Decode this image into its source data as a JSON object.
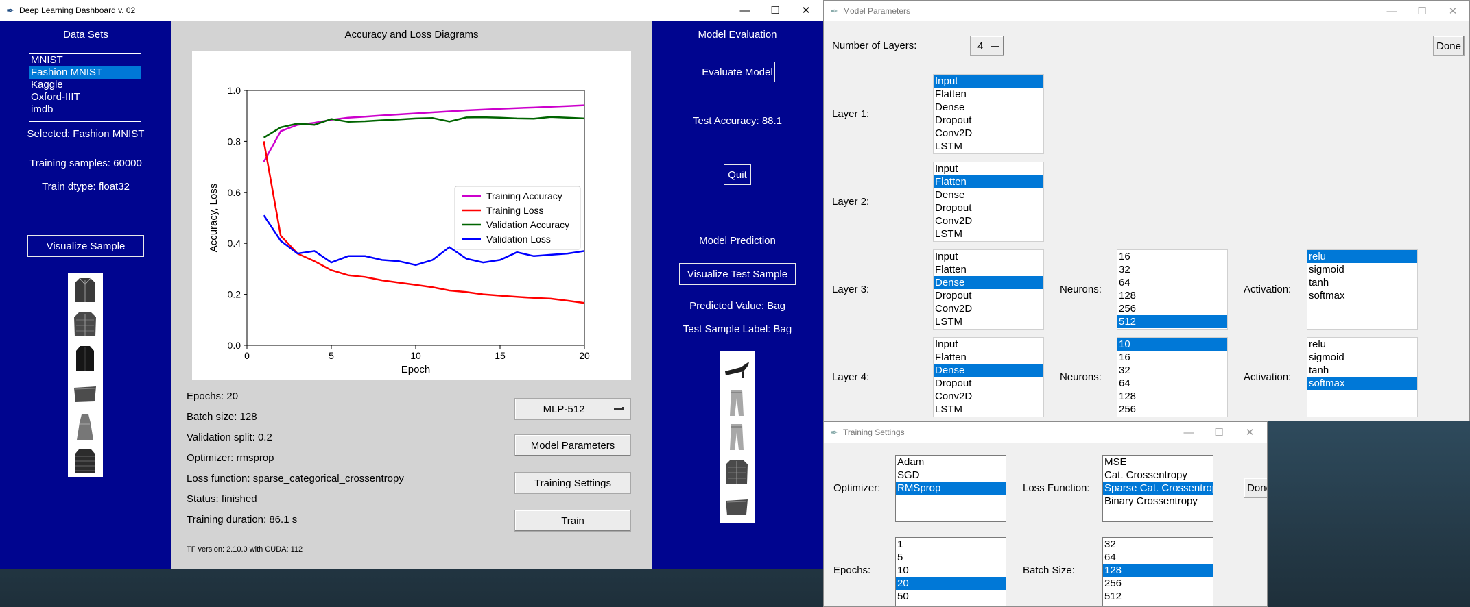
{
  "main_window": {
    "title": "Deep Learning Dashboard v. 02",
    "left_panel": {
      "heading": "Data Sets",
      "datasets": [
        {
          "label": "MNIST",
          "selected": false
        },
        {
          "label": "Fashion MNIST",
          "selected": true
        },
        {
          "label": "Kaggle",
          "selected": false
        },
        {
          "label": "Oxford-IIIT",
          "selected": false
        },
        {
          "label": "imdb",
          "selected": false
        }
      ],
      "selected_text": "Selected: Fashion MNIST",
      "training_samples": "Training samples: 60000",
      "train_dtype": "Train dtype: float32",
      "visualize_button": "Visualize Sample",
      "thumbnails": [
        "jacket-icon",
        "shirt-icon",
        "coat-icon",
        "bag-icon",
        "dress-icon",
        "puffer-jacket-icon"
      ]
    },
    "center_panel": {
      "heading": "Accuracy and Loss Diagrams",
      "info": [
        "Epochs: 20",
        "Batch size: 128",
        "Validation split: 0.2",
        "Optimizer: rmsprop",
        "Loss function: sparse_categorical_crossentropy",
        "Status: finished",
        "Training duration: 86.1 s"
      ],
      "tf_version": "TF version: 2.10.0 with CUDA: 112",
      "model_select": "MLP-512",
      "buttons": {
        "model_parameters": "Model Parameters",
        "training_settings": "Training Settings",
        "train": "Train"
      }
    },
    "right_panel": {
      "eval_heading": "Model Evaluation",
      "evaluate_button": "Evaluate Model",
      "test_accuracy": "Test Accuracy: 88.1",
      "quit_button": "Quit",
      "prediction_heading": "Model Prediction",
      "visualize_test_button": "Visualize Test Sample",
      "predicted_value": "Predicted Value: Bag",
      "test_sample_label": "Test Sample Label: Bag",
      "thumbnails": [
        "sandal-icon",
        "trouser-icon",
        "trouser-icon",
        "shirt-icon",
        "bag-icon"
      ]
    }
  },
  "model_params_window": {
    "title": "Model Parameters",
    "num_layers_label": "Number of Layers:",
    "num_layers_value": "4",
    "done_button": "Done",
    "layer_types": [
      "Input",
      "Flatten",
      "Dense",
      "Dropout",
      "Conv2D",
      "LSTM"
    ],
    "neurons_label": "Neurons:",
    "activation_label": "Activation:",
    "layers": [
      {
        "label": "Layer 1:",
        "type_selected": 0
      },
      {
        "label": "Layer 2:",
        "type_selected": 1
      },
      {
        "label": "Layer 3:",
        "type_selected": 2,
        "neurons": [
          "16",
          "32",
          "64",
          "128",
          "256",
          "512"
        ],
        "neurons_selected": 5,
        "activations": [
          "relu",
          "sigmoid",
          "tanh",
          "softmax"
        ],
        "activation_selected": 0
      },
      {
        "label": "Layer 4:",
        "type_selected": 2,
        "neurons": [
          "10",
          "16",
          "32",
          "64",
          "128",
          "256"
        ],
        "neurons_selected": 0,
        "activations": [
          "relu",
          "sigmoid",
          "tanh",
          "softmax"
        ],
        "activation_selected": 3
      }
    ]
  },
  "training_settings_window": {
    "title": "Training Settings",
    "optimizer_label": "Optimizer:",
    "optimizers": [
      {
        "label": "Adam",
        "selected": false
      },
      {
        "label": "SGD",
        "selected": false
      },
      {
        "label": "RMSprop",
        "selected": true
      }
    ],
    "loss_label": "Loss Function:",
    "losses": [
      {
        "label": "MSE",
        "selected": false
      },
      {
        "label": "Cat. Crossentropy",
        "selected": false
      },
      {
        "label": "Sparse Cat. Crossentropy",
        "selected": true
      },
      {
        "label": "Binary Crossentropy",
        "selected": false
      }
    ],
    "done_button": "Done",
    "epochs_label": "Epochs:",
    "epochs": [
      {
        "label": "1",
        "selected": false
      },
      {
        "label": "5",
        "selected": false
      },
      {
        "label": "10",
        "selected": false
      },
      {
        "label": "20",
        "selected": true
      },
      {
        "label": "50",
        "selected": false
      }
    ],
    "batch_label": "Batch Size:",
    "batch_sizes": [
      {
        "label": "32",
        "selected": false
      },
      {
        "label": "64",
        "selected": false
      },
      {
        "label": "128",
        "selected": true
      },
      {
        "label": "256",
        "selected": false
      },
      {
        "label": "512",
        "selected": false
      }
    ]
  },
  "colors": {
    "panel_blue": "#00058f",
    "panel_gray": "#d3d3d3",
    "selection": "#0078d7"
  },
  "chart_data": {
    "type": "line",
    "title": "",
    "xlabel": "Epoch",
    "ylabel": "Accuracy, Loss",
    "xlim": [
      0,
      20
    ],
    "ylim": [
      0.0,
      1.0
    ],
    "xticks": [
      0,
      5,
      10,
      15,
      20
    ],
    "yticks": [
      0.0,
      0.2,
      0.4,
      0.6,
      0.8,
      1.0
    ],
    "legend_position": "center-right",
    "x": [
      1,
      2,
      3,
      4,
      5,
      6,
      7,
      8,
      9,
      10,
      11,
      12,
      13,
      14,
      15,
      16,
      17,
      18,
      19,
      20
    ],
    "series": [
      {
        "name": "Training Accuracy",
        "color": "#cc00cc",
        "values": [
          0.72,
          0.84,
          0.865,
          0.873,
          0.885,
          0.893,
          0.897,
          0.902,
          0.906,
          0.91,
          0.914,
          0.918,
          0.922,
          0.925,
          0.928,
          0.931,
          0.933,
          0.936,
          0.939,
          0.942
        ]
      },
      {
        "name": "Training Loss",
        "color": "#ff0000",
        "values": [
          0.8,
          0.43,
          0.36,
          0.33,
          0.295,
          0.275,
          0.268,
          0.255,
          0.246,
          0.237,
          0.228,
          0.215,
          0.209,
          0.2,
          0.195,
          0.19,
          0.186,
          0.183,
          0.175,
          0.166
        ]
      },
      {
        "name": "Validation Accuracy",
        "color": "#006400",
        "values": [
          0.815,
          0.855,
          0.87,
          0.865,
          0.888,
          0.877,
          0.879,
          0.883,
          0.886,
          0.89,
          0.892,
          0.878,
          0.894,
          0.895,
          0.893,
          0.89,
          0.889,
          0.896,
          0.893,
          0.89
        ]
      },
      {
        "name": "Validation Loss",
        "color": "#0000ff",
        "values": [
          0.51,
          0.41,
          0.36,
          0.37,
          0.325,
          0.35,
          0.35,
          0.335,
          0.33,
          0.315,
          0.335,
          0.385,
          0.34,
          0.325,
          0.335,
          0.365,
          0.35,
          0.355,
          0.36,
          0.37
        ]
      }
    ]
  }
}
